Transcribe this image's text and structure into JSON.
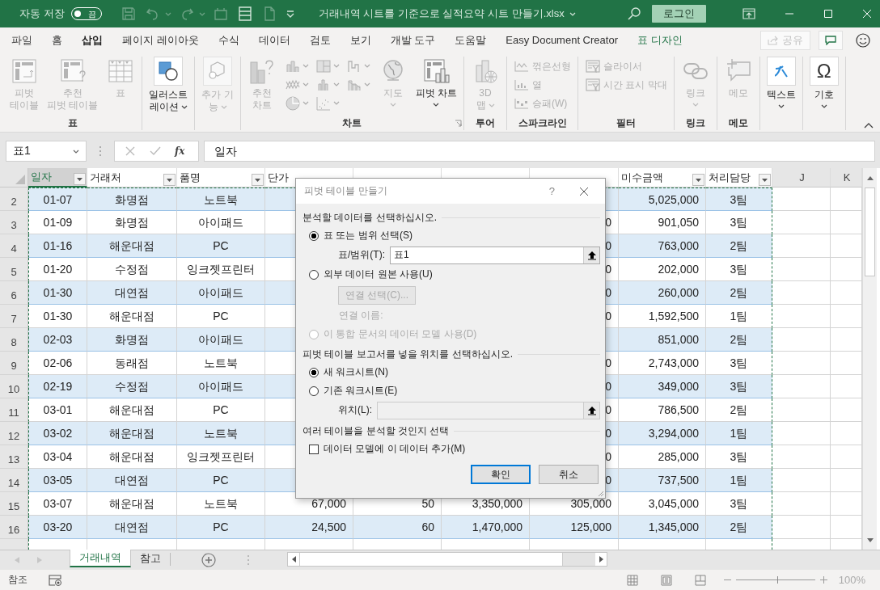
{
  "title_bar": {
    "autosave_label": "자동 저장",
    "autosave": {
      "on": false,
      "label": "끔"
    },
    "title": "거래내역 시트를 기준으로 실적요약 시트 만들기.xlsx",
    "login": "로그인"
  },
  "menu_tabs": [
    {
      "label": "파일",
      "selected": false,
      "kind": "tab"
    },
    {
      "label": "홈",
      "selected": false,
      "kind": "tab"
    },
    {
      "label": "삽입",
      "selected": true,
      "kind": "tab"
    },
    {
      "label": "페이지 레이아웃",
      "selected": false,
      "kind": "tab"
    },
    {
      "label": "수식",
      "selected": false,
      "kind": "tab"
    },
    {
      "label": "데이터",
      "selected": false,
      "kind": "tab"
    },
    {
      "label": "검토",
      "selected": false,
      "kind": "tab"
    },
    {
      "label": "보기",
      "selected": false,
      "kind": "tab"
    },
    {
      "label": "개발 도구",
      "selected": false,
      "kind": "tab"
    },
    {
      "label": "도움말",
      "selected": false,
      "kind": "tab"
    },
    {
      "label": "Easy Document Creator",
      "selected": false,
      "kind": "tab"
    },
    {
      "label": "표 디자인",
      "selected": false,
      "kind": "contextual"
    }
  ],
  "share": {
    "label": "공유",
    "disabled": true
  },
  "ribbon": [
    {
      "label": "표",
      "items": [
        {
          "kind": "large",
          "label": "피벗\n테이블",
          "disabled": true
        },
        {
          "kind": "large",
          "label": "추천\n피벗 테이블",
          "disabled": true
        },
        {
          "kind": "large",
          "label": "표",
          "disabled": true
        }
      ]
    },
    {
      "items": [
        {
          "kind": "large",
          "label": "일러스트\n레이션",
          "disabled": false,
          "dropdown": true
        }
      ]
    },
    {
      "items": [
        {
          "kind": "large",
          "label": "추가 기\n능",
          "disabled": true,
          "dropdown": true
        }
      ]
    },
    {
      "label": "차트",
      "launcher": true,
      "items": [
        {
          "kind": "large",
          "label": "추천\n차트",
          "disabled": true
        },
        {
          "kind": "gallery"
        },
        {
          "kind": "large",
          "label": "지도",
          "disabled": true,
          "dropdown": true
        },
        {
          "kind": "large",
          "label": "피벗 차트",
          "disabled": false,
          "dropdown": true
        }
      ]
    },
    {
      "label": "투어",
      "items": [
        {
          "kind": "large",
          "label": "3D\n맵",
          "disabled": true,
          "dropdown": true
        }
      ]
    },
    {
      "label": "스파크라인",
      "items": [
        {
          "kind": "small",
          "label": "꺾은선형",
          "disabled": true
        },
        {
          "kind": "small",
          "label": "열",
          "disabled": true
        },
        {
          "kind": "small",
          "label": "승패(W)",
          "disabled": true
        }
      ]
    },
    {
      "label": "필터",
      "items": [
        {
          "kind": "small",
          "label": "슬라이서",
          "disabled": true
        },
        {
          "kind": "small",
          "label": "시간 표시 막대",
          "disabled": true
        }
      ]
    },
    {
      "label": "링크",
      "items": [
        {
          "kind": "large",
          "label": "링크",
          "disabled": true,
          "dropdown": true
        }
      ]
    },
    {
      "label": "메모",
      "items": [
        {
          "kind": "large",
          "label": "메모",
          "disabled": true
        }
      ]
    },
    {
      "items": [
        {
          "kind": "large",
          "label": "텍스트",
          "disabled": false,
          "dropdown": true
        }
      ]
    },
    {
      "items": [
        {
          "kind": "large",
          "label": "기호",
          "disabled": false,
          "dropdown": true,
          "glyph": "Ω"
        }
      ]
    }
  ],
  "formula_bar": {
    "name_box": "표1",
    "fx": "fx",
    "value": "일자"
  },
  "columns": [
    {
      "label": "일자",
      "filter": true,
      "selected": true
    },
    {
      "label": "거래처",
      "filter": true,
      "selected": false
    },
    {
      "label": "품명",
      "filter": true,
      "selected": false
    },
    {
      "label": "단가",
      "filter": false,
      "selected": false
    },
    {
      "filter": false,
      "selected": false
    },
    {
      "filter": false,
      "selected": false
    },
    {
      "filter": false,
      "selected": false
    },
    {
      "label": "미수금액",
      "filter": true,
      "selected": false
    },
    {
      "label": "처리담당",
      "filter": true,
      "selected": false
    },
    {
      "label": "J",
      "filter": false,
      "selected": false
    },
    {
      "label": "K",
      "filter": false,
      "selected": false
    }
  ],
  "rows": [
    {
      "num": "2",
      "cells": [
        "01-07",
        "화명점",
        "노트북",
        null,
        null,
        null,
        null,
        "5,025,000",
        "3팀",
        null,
        null
      ]
    },
    {
      "num": "3",
      "cells": [
        "01-09",
        "화명점",
        "아이패드",
        null,
        null,
        null,
        "0",
        "901,050",
        "3팀",
        null,
        null
      ]
    },
    {
      "num": "4",
      "cells": [
        "01-16",
        "해운대점",
        "PC",
        null,
        null,
        null,
        "0",
        "763,000",
        "2팀",
        null,
        null
      ]
    },
    {
      "num": "5",
      "cells": [
        "01-20",
        "수정점",
        "잉크젯프린터",
        null,
        null,
        null,
        "0",
        "202,000",
        "3팀",
        null,
        null
      ]
    },
    {
      "num": "6",
      "cells": [
        "01-30",
        "대연점",
        "아이패드",
        null,
        null,
        null,
        "0",
        "260,000",
        "2팀",
        null,
        null
      ]
    },
    {
      "num": "7",
      "cells": [
        "01-30",
        "해운대점",
        "PC",
        null,
        null,
        null,
        "0",
        "1,592,500",
        "1팀",
        null,
        null
      ]
    },
    {
      "num": "8",
      "cells": [
        "02-03",
        "화명점",
        "아이패드",
        null,
        null,
        null,
        null,
        "851,000",
        "2팀",
        null,
        null
      ]
    },
    {
      "num": "9",
      "cells": [
        "02-06",
        "동래점",
        "노트북",
        null,
        null,
        null,
        "0",
        "2,743,000",
        "3팀",
        null,
        null
      ]
    },
    {
      "num": "10",
      "cells": [
        "02-19",
        "수정점",
        "아이패드",
        null,
        null,
        null,
        "0",
        "349,000",
        "3팀",
        null,
        null
      ]
    },
    {
      "num": "11",
      "cells": [
        "03-01",
        "해운대점",
        "PC",
        null,
        null,
        null,
        "0",
        "786,500",
        "2팀",
        null,
        null
      ]
    },
    {
      "num": "12",
      "cells": [
        "03-02",
        "해운대점",
        "노트북",
        null,
        null,
        null,
        "0",
        "3,294,000",
        "1팀",
        null,
        null
      ]
    },
    {
      "num": "13",
      "cells": [
        "03-04",
        "해운대점",
        "잉크젯프린터",
        null,
        null,
        null,
        "0",
        "285,000",
        "3팀",
        null,
        null
      ]
    },
    {
      "num": "14",
      "cells": [
        "03-05",
        "대연점",
        "PC",
        null,
        null,
        null,
        "0",
        "737,500",
        "1팀",
        null,
        null
      ]
    },
    {
      "num": "15",
      "cells": [
        "03-07",
        "해운대점",
        "노트북",
        "67,000",
        "50",
        "3,350,000",
        "305,000",
        "3,045,000",
        "3팀",
        null,
        null
      ]
    },
    {
      "num": "16",
      "cells": [
        "03-20",
        "대연점",
        "PC",
        "24,500",
        "60",
        "1,470,000",
        "125,000",
        "1,345,000",
        "2팀",
        null,
        null
      ]
    }
  ],
  "dialog": {
    "title": "피벗 테이블 만들기",
    "help": "?",
    "sections": [
      {
        "heading": "분석할 데이터를 선택하십시오.",
        "items": [
          {
            "kind": "radio",
            "label": "표 또는 범위 선택(S)",
            "selected": true,
            "disabled": false
          },
          {
            "kind": "field",
            "label": "표/범위(T):",
            "value": "표1",
            "disabled": false
          },
          {
            "kind": "radio",
            "label": "외부 데이터 원본 사용(U)",
            "selected": false,
            "disabled": false
          },
          {
            "kind": "button",
            "label": "연결 선택(C)...",
            "disabled": true
          },
          {
            "kind": "note",
            "label": "연결 이름:",
            "disabled": true
          },
          {
            "kind": "radio",
            "label": "이 통합 문서의 데이터 모델 사용(D)",
            "selected": false,
            "disabled": true
          }
        ]
      },
      {
        "heading": "피벗 테이블 보고서를 넣을 위치를 선택하십시오.",
        "items": [
          {
            "kind": "radio",
            "label": "새 워크시트(N)",
            "selected": true,
            "disabled": false
          },
          {
            "kind": "radio",
            "label": "기존 워크시트(E)",
            "selected": false,
            "disabled": false
          },
          {
            "kind": "field",
            "label": "위치(L):",
            "disabled": true
          }
        ]
      },
      {
        "heading": "여러 테이블을 분석할 것인지 선택",
        "items": [
          {
            "kind": "checkbox",
            "label": "데이터 모델에 이 데이터 추가(M)",
            "checked": false
          }
        ]
      }
    ],
    "buttons": [
      {
        "label": "확인",
        "default": true
      },
      {
        "label": "취소",
        "default": false
      }
    ]
  },
  "sheet_tabs": [
    {
      "label": "거래내역",
      "selected": true
    },
    {
      "label": "참고",
      "selected": false
    }
  ],
  "status_bar": {
    "mode": "참조",
    "zoom_slider": {
      "level": 0.52
    },
    "zoom": "100%"
  }
}
